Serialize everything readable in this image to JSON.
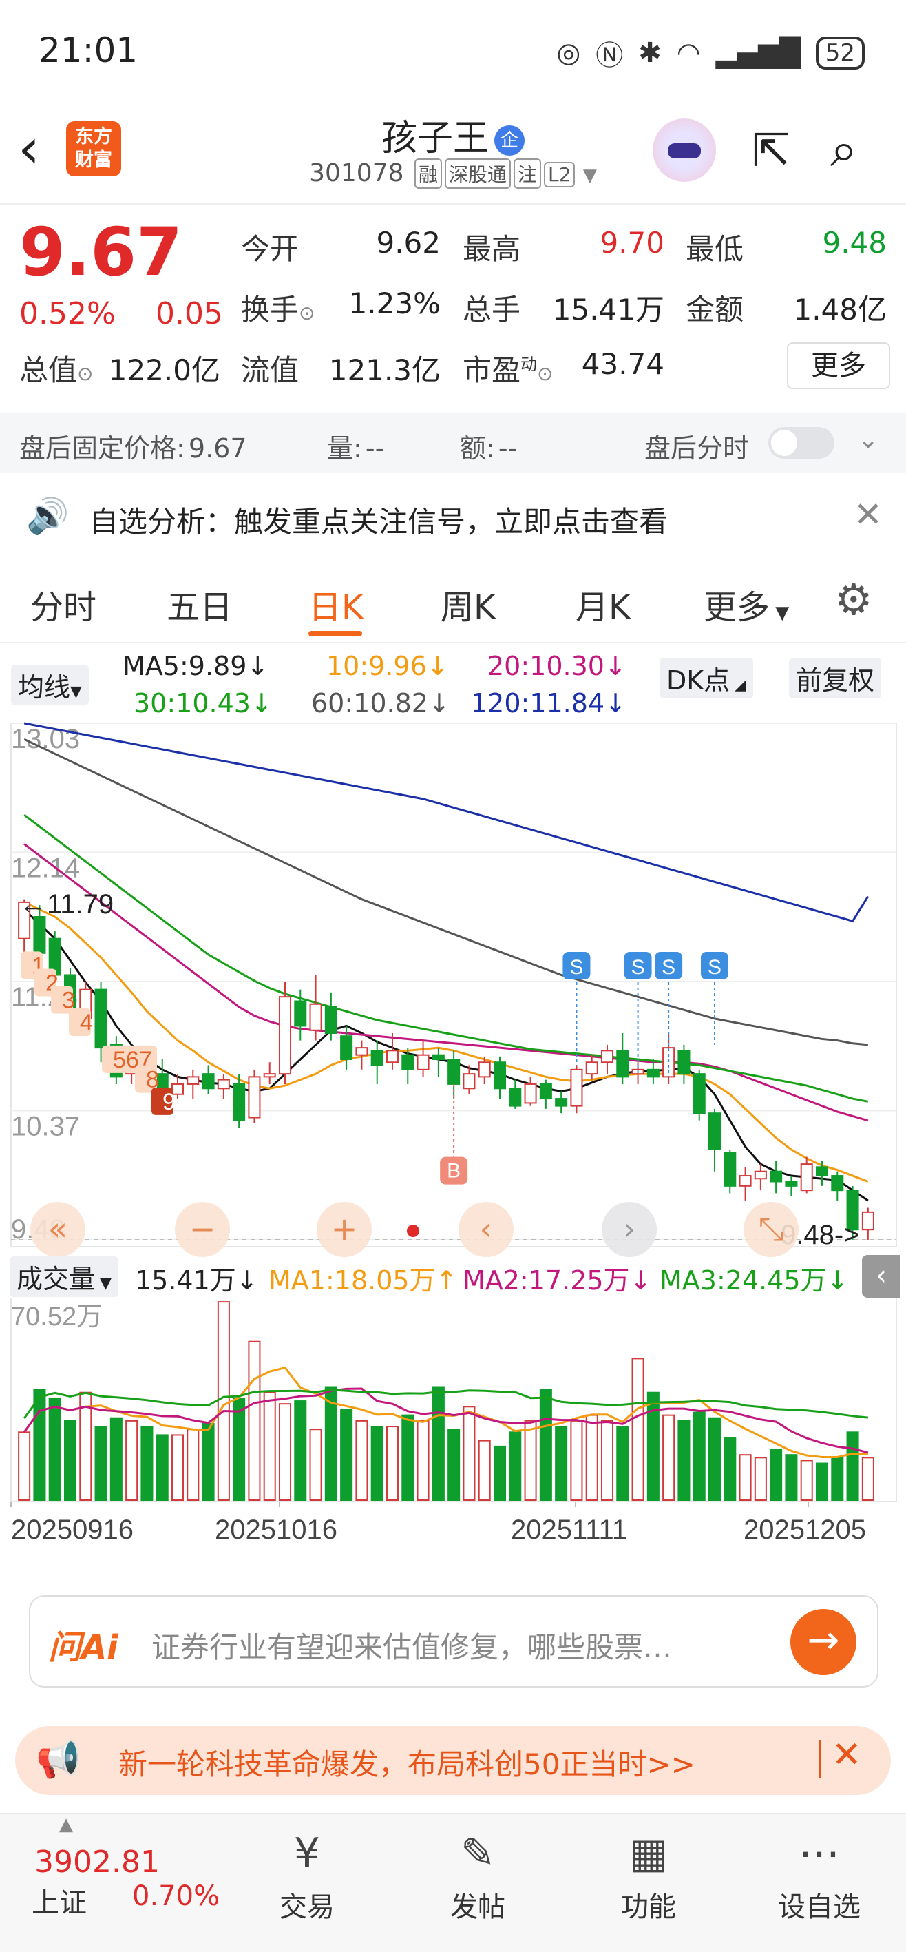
{
  "status": {
    "time": "21:01",
    "battery": "52"
  },
  "header": {
    "logo_text": "东方财富",
    "stock_name": "孩子王",
    "badge": "企",
    "code": "301078",
    "tags": [
      "融",
      "深股通",
      "注",
      "L2"
    ]
  },
  "quote": {
    "price": "9.67",
    "change_pct": "0.52%",
    "change": "0.05",
    "fields": [
      {
        "label": "今开",
        "value": "9.62",
        "color": "#222"
      },
      {
        "label": "最高",
        "value": "9.70",
        "color": "#e02a2a"
      },
      {
        "label": "最低",
        "value": "9.48",
        "color": "#0e9e2e"
      },
      {
        "label": "换手",
        "value": "1.23%",
        "color": "#222"
      },
      {
        "label": "总手",
        "value": "15.41万",
        "color": "#222"
      },
      {
        "label": "金额",
        "value": "1.48亿",
        "color": "#222"
      },
      {
        "label": "总值",
        "value": "122.0亿",
        "color": "#222"
      },
      {
        "label": "流值",
        "value": "121.3亿",
        "color": "#222"
      },
      {
        "label": "市盈",
        "value": "43.74",
        "color": "#222",
        "sup": "动"
      }
    ],
    "more_label": "更多"
  },
  "after_hours": {
    "fixed_price_label": "盘后固定价格:",
    "fixed_price": "9.67",
    "vol_label": "量:",
    "vol": "--",
    "amt_label": "额:",
    "amt": "--",
    "intraday_label": "盘后分时"
  },
  "alert": {
    "text": "自选分析：触发重点关注信号，立即点击查看"
  },
  "tabs": [
    "分时",
    "五日",
    "日K",
    "周K",
    "月K",
    "更多"
  ],
  "active_tab": 2,
  "ma": {
    "selector": "均线",
    "items": [
      {
        "text": "MA5:9.89",
        "color": "#222"
      },
      {
        "text": "10:9.96",
        "color": "#f39c12"
      },
      {
        "text": "20:10.30",
        "color": "#c2187e"
      },
      {
        "text": "30:10.43",
        "color": "#18a018"
      },
      {
        "text": "60:10.82",
        "color": "#555555"
      },
      {
        "text": "120:11.84",
        "color": "#1a2fa8"
      }
    ],
    "dk_label": "DK点",
    "adj_label": "前复权"
  },
  "chart_data": {
    "type": "candlestick",
    "y_axis_labels": [
      "13.03",
      "12.14",
      "11.25",
      "10.37",
      "9.48"
    ],
    "ylim": [
      9.48,
      13.03
    ],
    "high_label": "11.79",
    "low_label": "9.48",
    "x_labels": [
      "20250916",
      "20251016",
      "20251111",
      "20251205"
    ],
    "markers": {
      "count_labels": [
        "1",
        "2",
        "3",
        "4",
        "567",
        "8",
        "9"
      ],
      "buy": "B",
      "sell": "S"
    },
    "candles": [
      [
        11.55,
        11.8,
        11.4,
        11.82
      ],
      [
        11.7,
        11.45,
        11.4,
        11.78
      ],
      [
        11.55,
        11.3,
        11.2,
        11.6
      ],
      [
        11.3,
        11.05,
        11.0,
        11.35
      ],
      [
        11.0,
        11.2,
        10.95,
        11.25
      ],
      [
        11.2,
        10.8,
        10.7,
        11.25
      ],
      [
        10.82,
        10.6,
        10.55,
        10.88
      ],
      [
        10.62,
        10.7,
        10.55,
        10.75
      ],
      [
        10.7,
        10.62,
        10.5,
        10.8
      ],
      [
        10.62,
        10.5,
        10.4,
        10.72
      ],
      [
        10.48,
        10.55,
        10.45,
        10.62
      ],
      [
        10.55,
        10.6,
        10.45,
        10.65
      ],
      [
        10.62,
        10.52,
        10.48,
        10.68
      ],
      [
        10.52,
        10.58,
        10.45,
        10.62
      ],
      [
        10.55,
        10.3,
        10.25,
        10.62
      ],
      [
        10.32,
        10.6,
        10.28,
        10.65
      ],
      [
        10.6,
        10.62,
        10.55,
        10.7
      ],
      [
        10.62,
        11.15,
        10.55,
        11.25
      ],
      [
        11.12,
        10.95,
        10.85,
        11.2
      ],
      [
        10.92,
        11.1,
        10.85,
        11.3
      ],
      [
        11.08,
        10.9,
        10.85,
        11.18
      ],
      [
        10.88,
        10.72,
        10.65,
        10.95
      ],
      [
        10.75,
        10.8,
        10.65,
        10.85
      ],
      [
        10.78,
        10.68,
        10.55,
        10.85
      ],
      [
        10.7,
        10.78,
        10.65,
        10.9
      ],
      [
        10.75,
        10.65,
        10.55,
        10.8
      ],
      [
        10.65,
        10.75,
        10.6,
        10.85
      ],
      [
        10.75,
        10.72,
        10.6,
        10.8
      ],
      [
        10.72,
        10.55,
        10.45,
        10.78
      ],
      [
        10.52,
        10.62,
        10.48,
        10.68
      ],
      [
        10.6,
        10.7,
        10.55,
        10.74
      ],
      [
        10.7,
        10.52,
        10.45,
        10.74
      ],
      [
        10.52,
        10.4,
        10.38,
        10.58
      ],
      [
        10.42,
        10.55,
        10.4,
        10.6
      ],
      [
        10.55,
        10.45,
        10.38,
        10.58
      ],
      [
        10.45,
        10.4,
        10.35,
        10.5
      ],
      [
        10.4,
        10.65,
        10.35,
        10.68
      ],
      [
        10.62,
        10.7,
        10.58,
        10.75
      ],
      [
        10.7,
        10.78,
        10.62,
        10.82
      ],
      [
        10.78,
        10.6,
        10.55,
        10.9
      ],
      [
        10.62,
        10.65,
        10.55,
        10.7
      ],
      [
        10.65,
        10.6,
        10.55,
        10.72
      ],
      [
        10.6,
        10.8,
        10.55,
        10.9
      ],
      [
        10.78,
        10.62,
        10.55,
        10.82
      ],
      [
        10.62,
        10.35,
        10.3,
        10.65
      ],
      [
        10.35,
        10.1,
        9.95,
        10.38
      ],
      [
        10.08,
        9.85,
        9.8,
        10.1
      ],
      [
        9.85,
        9.92,
        9.75,
        9.98
      ],
      [
        9.9,
        9.95,
        9.82,
        10.0
      ],
      [
        9.95,
        9.88,
        9.8,
        10.02
      ],
      [
        9.88,
        9.85,
        9.78,
        9.92
      ],
      [
        9.82,
        10.0,
        9.8,
        10.05
      ],
      [
        9.98,
        9.92,
        9.85,
        10.02
      ],
      [
        9.92,
        9.82,
        9.75,
        9.95
      ],
      [
        9.82,
        9.55,
        9.48,
        9.85
      ],
      [
        9.55,
        9.67,
        9.48,
        9.7
      ]
    ],
    "ma_lines": [
      {
        "name": "MA5",
        "color": "#111111",
        "values": [
          11.75,
          11.65,
          11.55,
          11.4,
          11.25,
          11.12,
          10.95,
          10.82,
          10.72,
          10.65,
          10.6,
          10.58,
          10.56,
          10.55,
          10.52,
          10.5,
          10.52,
          10.62,
          10.72,
          10.82,
          10.92,
          10.95,
          10.9,
          10.84,
          10.8,
          10.76,
          10.74,
          10.72,
          10.7,
          10.66,
          10.64,
          10.62,
          10.58,
          10.55,
          10.52,
          10.5,
          10.52,
          10.56,
          10.6,
          10.62,
          10.64,
          10.64,
          10.65,
          10.66,
          10.6,
          10.48,
          10.3,
          10.12,
          10.0,
          9.95,
          9.92,
          9.91,
          9.9,
          9.89,
          9.82,
          9.75
        ]
      },
      {
        "name": "MA10",
        "color": "#f39c12",
        "values": [
          11.8,
          11.75,
          11.7,
          11.62,
          11.52,
          11.42,
          11.3,
          11.18,
          11.05,
          10.95,
          10.85,
          10.78,
          10.7,
          10.64,
          10.58,
          10.54,
          10.52,
          10.54,
          10.58,
          10.62,
          10.68,
          10.72,
          10.74,
          10.76,
          10.78,
          10.78,
          10.79,
          10.8,
          10.78,
          10.75,
          10.72,
          10.69,
          10.66,
          10.63,
          10.6,
          10.58,
          10.57,
          10.58,
          10.6,
          10.61,
          10.62,
          10.62,
          10.62,
          10.62,
          10.6,
          10.55,
          10.48,
          10.38,
          10.28,
          10.18,
          10.1,
          10.04,
          9.99,
          9.96,
          9.92,
          9.88
        ]
      },
      {
        "name": "MA20",
        "color": "#c2187e",
        "values": [
          12.2,
          12.12,
          12.04,
          11.96,
          11.88,
          11.8,
          11.72,
          11.64,
          11.56,
          11.48,
          11.4,
          11.32,
          11.24,
          11.16,
          11.08,
          11.02,
          10.98,
          10.95,
          10.93,
          10.92,
          10.91,
          10.9,
          10.89,
          10.88,
          10.87,
          10.86,
          10.85,
          10.84,
          10.83,
          10.82,
          10.81,
          10.8,
          10.79,
          10.78,
          10.77,
          10.76,
          10.75,
          10.74,
          10.73,
          10.72,
          10.71,
          10.7,
          10.7,
          10.7,
          10.69,
          10.67,
          10.64,
          10.6,
          10.56,
          10.52,
          10.48,
          10.44,
          10.4,
          10.36,
          10.33,
          10.3
        ]
      },
      {
        "name": "MA30",
        "color": "#18a018",
        "values": [
          12.4,
          12.32,
          12.24,
          12.16,
          12.08,
          12.0,
          11.92,
          11.84,
          11.76,
          11.68,
          11.6,
          11.52,
          11.44,
          11.38,
          11.32,
          11.26,
          11.21,
          11.17,
          11.14,
          11.11,
          11.08,
          11.05,
          11.02,
          10.99,
          10.97,
          10.95,
          10.93,
          10.91,
          10.89,
          10.87,
          10.85,
          10.83,
          10.81,
          10.79,
          10.78,
          10.77,
          10.76,
          10.75,
          10.74,
          10.73,
          10.72,
          10.71,
          10.7,
          10.69,
          10.68,
          10.66,
          10.64,
          10.62,
          10.6,
          10.58,
          10.56,
          10.54,
          10.51,
          10.48,
          10.45,
          10.43
        ]
      },
      {
        "name": "MA60",
        "color": "#555555",
        "values": [
          12.92,
          12.87,
          12.82,
          12.77,
          12.72,
          12.67,
          12.62,
          12.57,
          12.52,
          12.47,
          12.42,
          12.37,
          12.32,
          12.27,
          12.22,
          12.17,
          12.12,
          12.07,
          12.02,
          11.97,
          11.92,
          11.87,
          11.82,
          11.78,
          11.74,
          11.7,
          11.66,
          11.62,
          11.58,
          11.54,
          11.5,
          11.46,
          11.42,
          11.38,
          11.34,
          11.3,
          11.27,
          11.24,
          11.21,
          11.18,
          11.15,
          11.12,
          11.09,
          11.06,
          11.03,
          11.0,
          10.98,
          10.96,
          10.94,
          10.92,
          10.9,
          10.88,
          10.86,
          10.85,
          10.83,
          10.82
        ]
      },
      {
        "name": "MA120",
        "color": "#1a2fa8",
        "values": [
          13.03,
          13.01,
          12.99,
          12.97,
          12.95,
          12.93,
          12.91,
          12.89,
          12.87,
          12.85,
          12.83,
          12.81,
          12.79,
          12.77,
          12.75,
          12.73,
          12.71,
          12.69,
          12.67,
          12.65,
          12.63,
          12.61,
          12.59,
          12.57,
          12.55,
          12.53,
          12.51,
          12.48,
          12.45,
          12.42,
          12.39,
          12.36,
          12.33,
          12.3,
          12.27,
          12.24,
          12.21,
          12.18,
          12.15,
          12.12,
          12.09,
          12.06,
          12.03,
          12.0,
          11.97,
          11.94,
          11.91,
          11.88,
          11.85,
          11.82,
          11.79,
          11.76,
          11.73,
          11.7,
          11.67,
          11.84
        ]
      }
    ]
  },
  "volume": {
    "selector": "成交量",
    "current": "15.41万",
    "ma1": "MA1:18.05万",
    "ma2": "MA2:17.25万",
    "ma3": "MA3:24.45万",
    "max_label": "70.52万",
    "values": [
      24,
      39,
      36,
      28,
      38,
      26,
      29,
      28,
      26,
      23,
      23,
      25,
      27,
      70,
      36,
      56,
      38,
      34,
      35,
      25,
      40,
      32,
      28,
      26,
      26,
      30,
      28,
      40,
      25,
      33,
      21,
      19,
      24,
      28,
      39,
      26,
      28,
      30,
      28,
      26,
      50,
      38,
      30,
      28,
      31,
      29,
      22,
      16,
      15,
      18,
      16,
      14,
      13,
      15,
      24,
      15
    ],
    "max": 70.52
  },
  "ai": {
    "logo": "问Ai",
    "placeholder": "证券行业有望迎来估值修复，哪些股票…"
  },
  "banner": {
    "text": "新一轮科技革命爆发，布局科创50正当时>>"
  },
  "bottom_nav": {
    "index_value": "3902.81",
    "index_name": "上证",
    "index_change": "0.70%",
    "items": [
      {
        "label": "交易",
        "icon": "trade-icon"
      },
      {
        "label": "发帖",
        "icon": "post-icon"
      },
      {
        "label": "功能",
        "icon": "grid-icon"
      },
      {
        "label": "设自选",
        "icon": "more-icon"
      }
    ]
  }
}
